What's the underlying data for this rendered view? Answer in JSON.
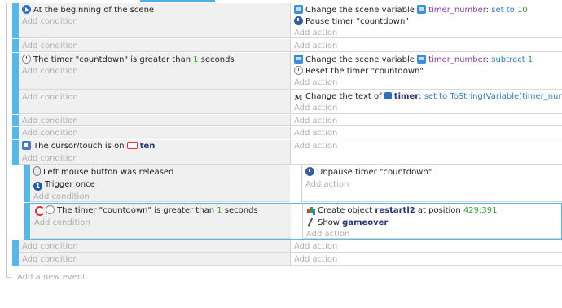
{
  "placeholders": {
    "add_condition": "Add condition",
    "add_action": "Add action",
    "add_event": "Add a new event"
  },
  "events": [
    {
      "conditions": [
        {
          "icon": "scene-start-icon",
          "text": "At the beginning of the scene"
        }
      ],
      "actions": [
        {
          "icon": "variable-icon",
          "parts": [
            "Change the scene variable ",
            "timer_number",
            ": ",
            "set to",
            " ",
            "10"
          ]
        },
        {
          "icon": "timer-icon",
          "parts": [
            "Pause timer ",
            "\"countdown\""
          ]
        }
      ]
    },
    {
      "conditions": [],
      "actions": []
    },
    {
      "conditions": [
        {
          "icon": "timer-icon",
          "parts": [
            "The timer ",
            "\"countdown\"",
            " is greater than ",
            "1",
            " seconds"
          ]
        }
      ],
      "actions": [
        {
          "icon": "variable-icon",
          "parts": [
            "Change the scene variable ",
            "timer_number",
            ": ",
            "subtract",
            " ",
            "1"
          ]
        },
        {
          "icon": "timer-icon",
          "parts": [
            "Reset the timer ",
            "\"countdown\""
          ]
        }
      ]
    },
    {
      "conditions": [],
      "actions": [
        {
          "icon": "text-icon",
          "parts": [
            "Change the text of ",
            "timer",
            ": ",
            "set to",
            " ",
            "ToString(Variable(timer_number))"
          ]
        }
      ]
    },
    {
      "conditions": [],
      "actions": []
    },
    {
      "conditions": [],
      "actions": []
    },
    {
      "conditions": [
        {
          "icon": "cursor-touch-icon",
          "parts": [
            "The cursor/touch is on ",
            "ten"
          ]
        }
      ],
      "actions": [],
      "sub_events": [
        {
          "conditions": [
            {
              "icon": "mouse-icon",
              "parts": [
                "Left",
                " mouse button was released"
              ]
            },
            {
              "icon": "trigger-once-icon",
              "text": "Trigger once"
            }
          ],
          "actions": [
            {
              "icon": "timer-icon",
              "parts": [
                "Unpause timer ",
                "\"countdown\""
              ]
            }
          ]
        },
        {
          "conditions": [
            {
              "icon": "timer-icon",
              "parts": [
                "The timer ",
                "\"countdown\"",
                " is greater than ",
                "1",
                " seconds"
              ]
            }
          ],
          "actions": [
            {
              "icon": "create-object-icon",
              "parts": [
                "Create object ",
                "restartl2",
                " at position ",
                "429;391"
              ]
            },
            {
              "icon": "show-icon",
              "parts": [
                "Show ",
                "gameover"
              ]
            }
          ]
        }
      ]
    },
    {
      "conditions": [],
      "actions": []
    },
    {
      "conditions": [],
      "actions": []
    }
  ]
}
